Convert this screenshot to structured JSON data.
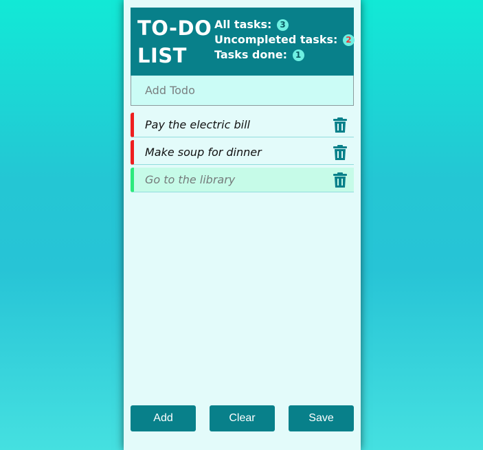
{
  "header": {
    "title_line1": "TO-DO",
    "title_line2": "LIST",
    "all_tasks_label": "All tasks:",
    "all_tasks_count": "3",
    "uncompleted_label": "Uncompleted tasks:",
    "uncompleted_count": "2",
    "done_label": "Tasks done:",
    "done_count": "1"
  },
  "add_todo": {
    "placeholder": "Add Todo",
    "value": ""
  },
  "tasks": [
    {
      "text": "Pay the electric bill",
      "done": false,
      "icon": "trash-icon"
    },
    {
      "text": "Make soup for dinner",
      "done": false,
      "icon": "trash-icon"
    },
    {
      "text": "Go to the library",
      "done": true,
      "icon": "trash-icon"
    }
  ],
  "buttons": {
    "add": "Add",
    "clear": "Clear",
    "save": "Save"
  },
  "colors": {
    "accent": "#08808a",
    "panel": "#e3fbfa",
    "incomplete_marker": "#ee1f1f",
    "done_marker": "#2cea7c",
    "done_row": "#c6fbe8",
    "badge": "#6ef0e2"
  }
}
